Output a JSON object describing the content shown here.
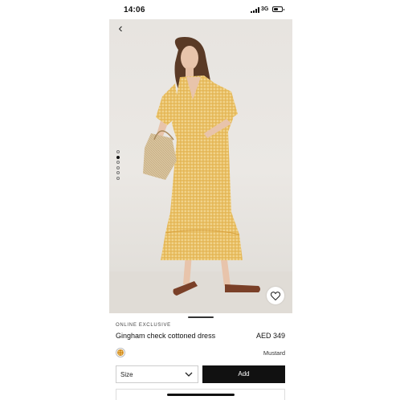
{
  "status_bar": {
    "time": "14:06",
    "network": "3G",
    "battery_icon": "battery-icon"
  },
  "gallery": {
    "dots_total": 6,
    "active_index": 1,
    "icons": [
      "back-chevron-icon",
      "heart-icon"
    ]
  },
  "product": {
    "label": "ONLINE EXCLUSIVE",
    "name": "Gingham check cottoned dress",
    "price": "AED 349",
    "color_name": "Mustard",
    "swatch_color": "#e5b44e"
  },
  "actions": {
    "size_placeholder": "Size",
    "add_label": "Add"
  },
  "colors": {
    "dress": "#e8bf62",
    "background": "#e9e6e2",
    "button": "#111111"
  }
}
